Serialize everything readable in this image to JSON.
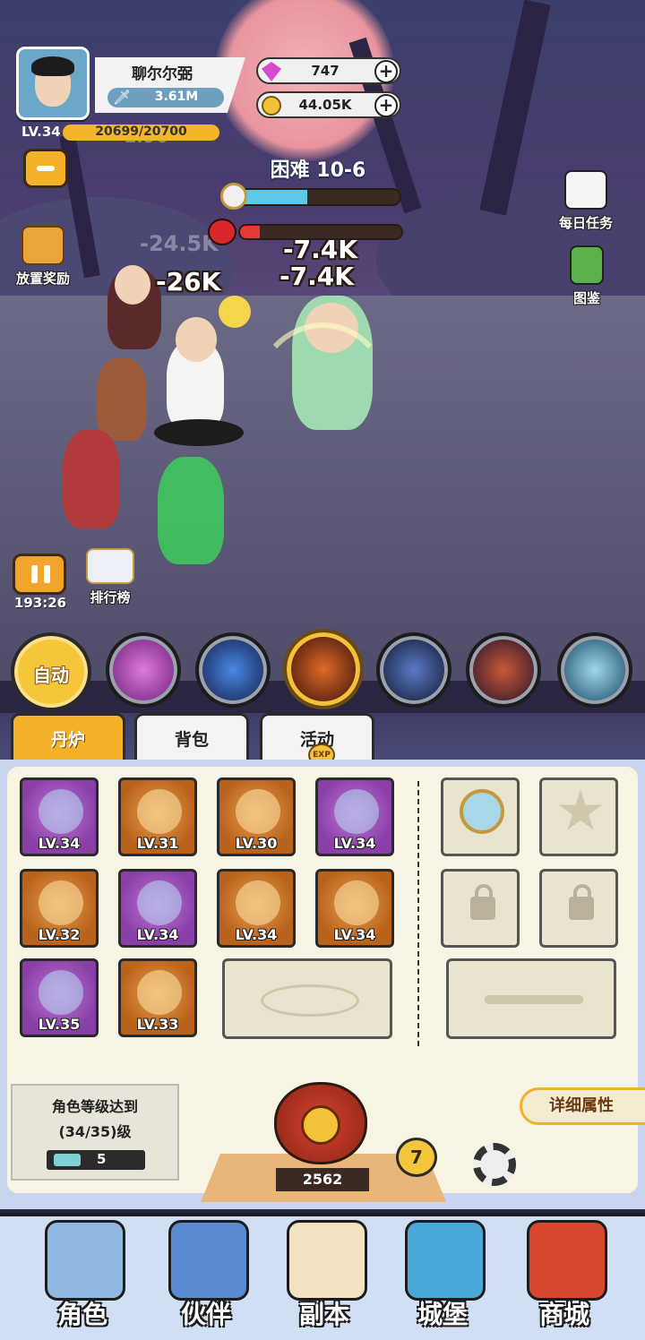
{
  "player": {
    "name": "聊尔尔弼",
    "power": "3.61M",
    "level": "LV.34",
    "exp": "20699/20700"
  },
  "currencies": [
    {
      "icon": "gem-icon",
      "value": "747"
    },
    {
      "icon": "coin-icon",
      "value": "44.05K"
    }
  ],
  "stage": {
    "title": "困难 10-6",
    "time_progress": 0.43,
    "boss_hp": 0.12
  },
  "damage_numbers": [
    "-26K",
    "-7.4K",
    "-7.4K",
    "-24.5K",
    "-1.96"
  ],
  "side_buttons": {
    "idle_reward": "放置奖励",
    "daily_task": "每日任务",
    "codex": "图鉴",
    "ranking": "排行榜"
  },
  "pause": {
    "timer": "193:26"
  },
  "skill_bar": {
    "auto_label": "自动"
  },
  "tabs": [
    "丹炉",
    "背包",
    "活动"
  ],
  "equipment": [
    {
      "level": "LV.34",
      "rarity": "purple",
      "icon": "sword-icon"
    },
    {
      "level": "LV.31",
      "rarity": "orange",
      "icon": "scroll-icon"
    },
    {
      "level": "LV.30",
      "rarity": "orange",
      "icon": "armor-icon"
    },
    {
      "level": "LV.34",
      "rarity": "purple",
      "icon": "dragon-orb-icon"
    },
    {
      "level": "LV.32",
      "rarity": "orange",
      "icon": "spear-icon"
    },
    {
      "level": "LV.34",
      "rarity": "purple",
      "icon": "jade-disc-icon"
    },
    {
      "level": "LV.34",
      "rarity": "orange",
      "icon": "ring-icon"
    },
    {
      "level": "LV.34",
      "rarity": "orange",
      "icon": "pearl-icon"
    },
    {
      "level": "LV.35",
      "rarity": "purple",
      "icon": "belt-icon"
    },
    {
      "level": "LV.33",
      "rarity": "orange",
      "icon": "boots-icon"
    }
  ],
  "requirement": {
    "line1": "角色等级达到",
    "line2": "(34/35)级",
    "ticket_count": "5"
  },
  "furnace": {
    "count": "2562",
    "coins": "7"
  },
  "detail_button": "详细属性",
  "nav": [
    "角色",
    "伙伴",
    "副本",
    "城堡",
    "商城"
  ],
  "colors": {
    "accent": "#f4b12a",
    "panel": "#f8f4e3"
  }
}
